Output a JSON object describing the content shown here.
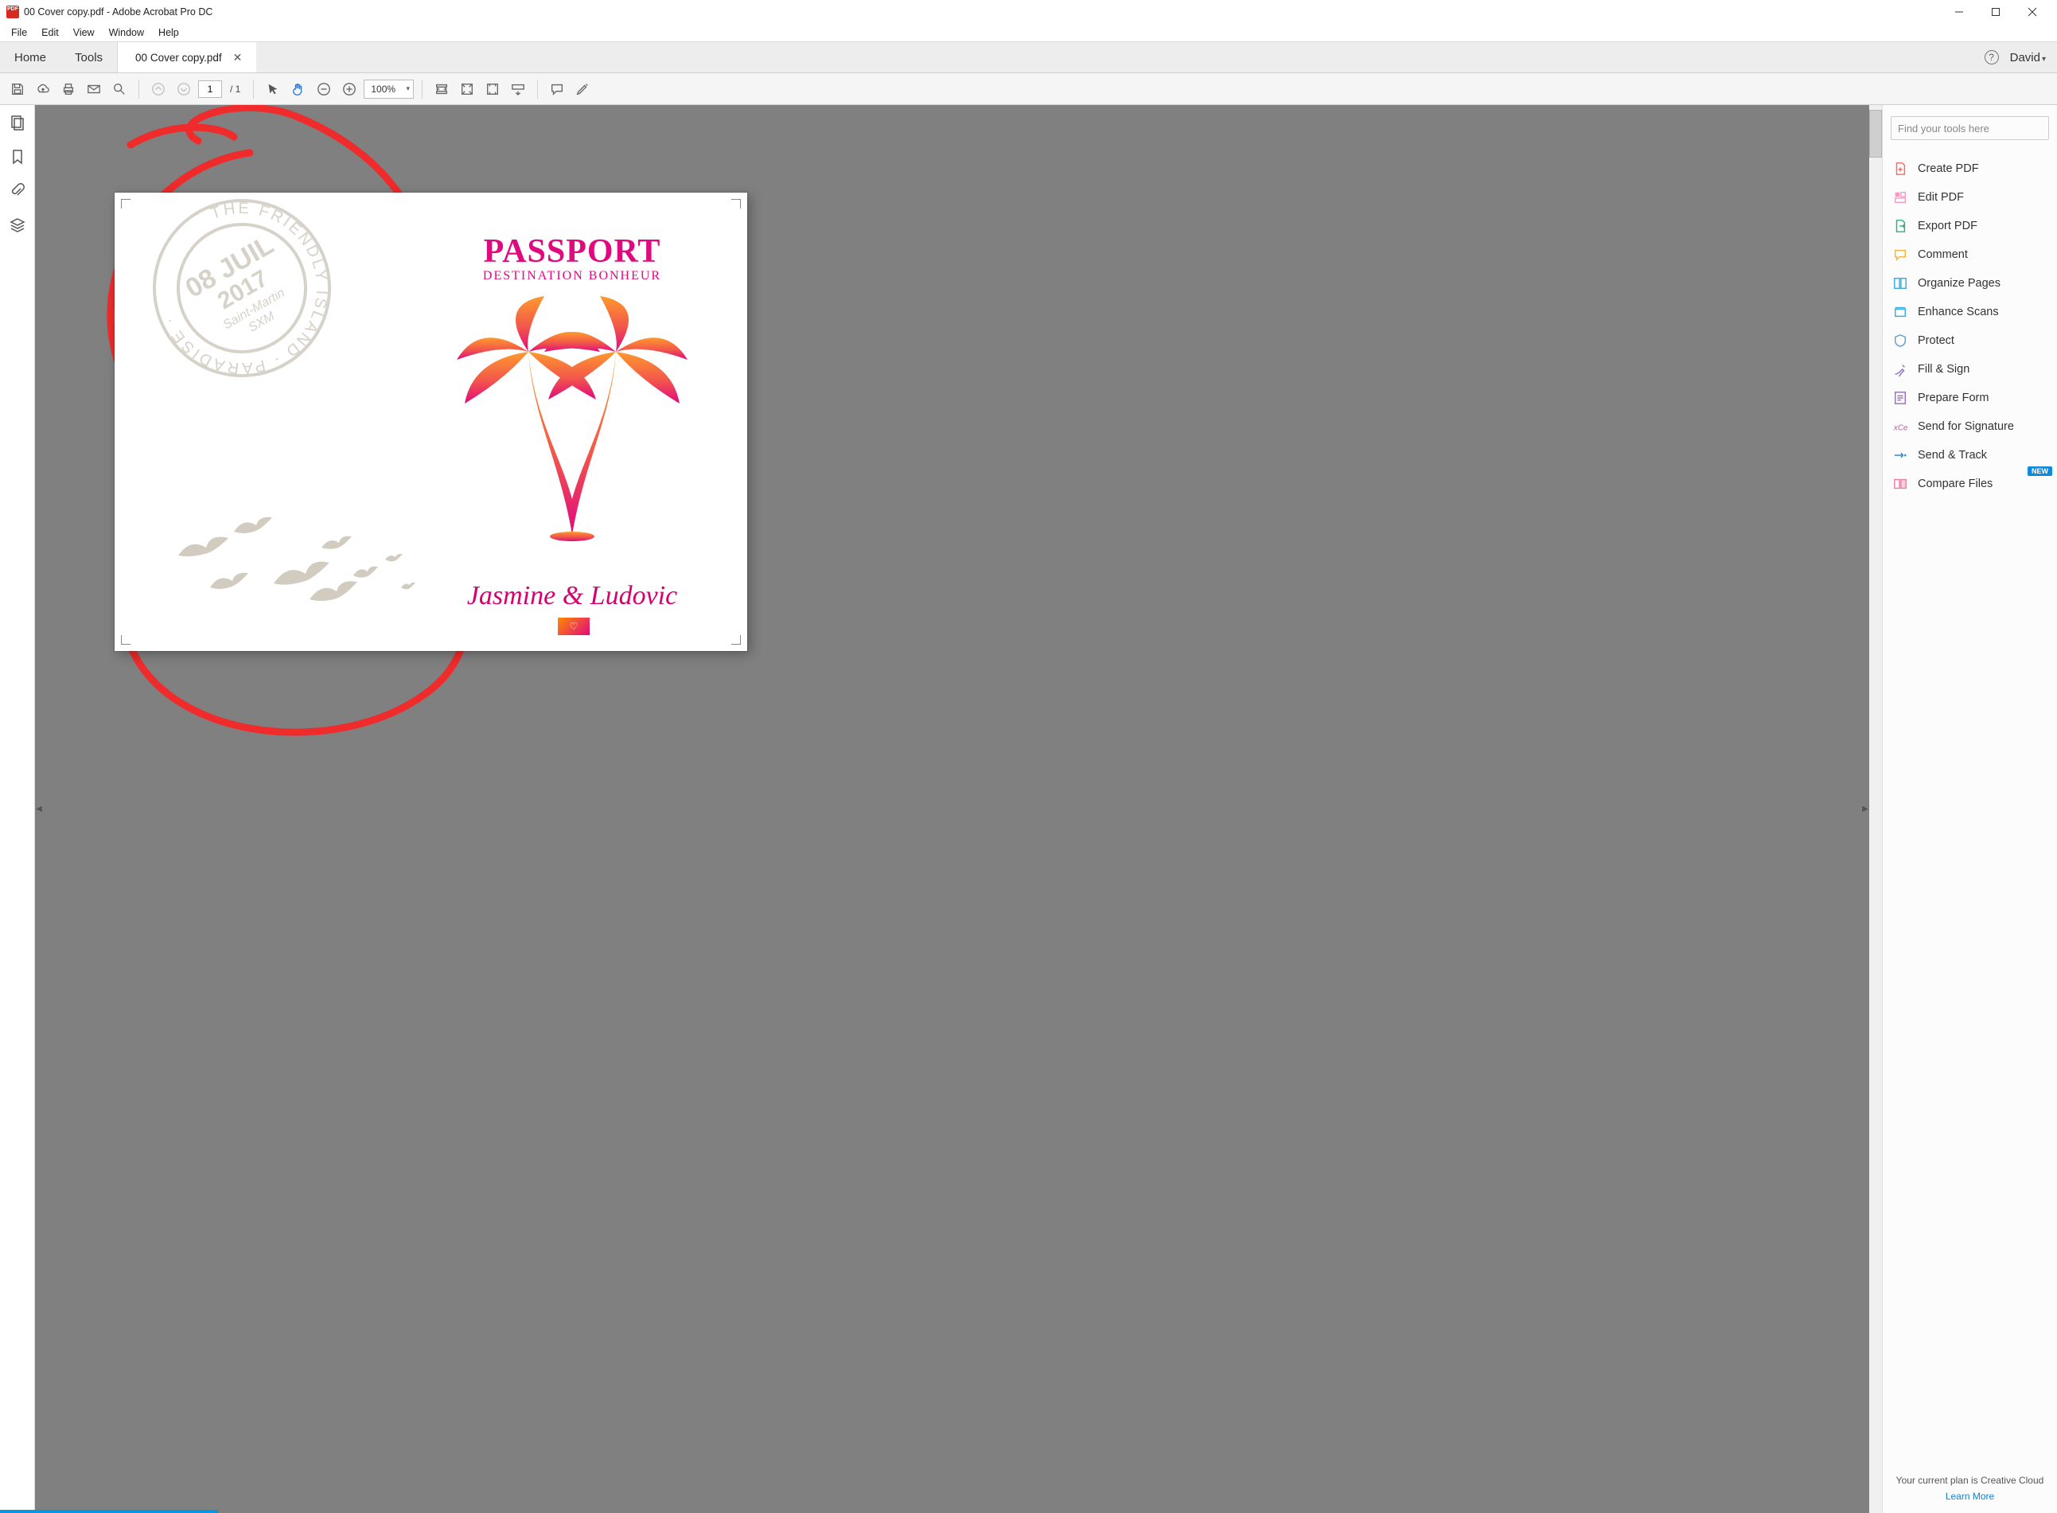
{
  "titlebar": {
    "title": "00 Cover copy.pdf - Adobe Acrobat Pro DC"
  },
  "menubar": {
    "items": [
      "File",
      "Edit",
      "View",
      "Window",
      "Help"
    ]
  },
  "tabstrip": {
    "home": "Home",
    "tools": "Tools",
    "filetab": "00 Cover copy.pdf",
    "user": "David"
  },
  "toolbar": {
    "page_current": "1",
    "page_total": "1",
    "zoom": "100%"
  },
  "rightpanel": {
    "search_placeholder": "Find your tools here",
    "items": [
      {
        "label": "Create PDF",
        "color": "#f06f5f",
        "icon": "file-plus"
      },
      {
        "label": "Edit PDF",
        "color": "#f29ac0",
        "icon": "edit"
      },
      {
        "label": "Export PDF",
        "color": "#28b37d",
        "icon": "export"
      },
      {
        "label": "Comment",
        "color": "#f2b63d",
        "icon": "comment"
      },
      {
        "label": "Organize Pages",
        "color": "#3aa9e0",
        "icon": "organize"
      },
      {
        "label": "Enhance Scans",
        "color": "#3aa9e0",
        "icon": "scan"
      },
      {
        "label": "Protect",
        "color": "#6aa0c9",
        "icon": "shield"
      },
      {
        "label": "Fill & Sign",
        "color": "#8a6fd0",
        "icon": "pen"
      },
      {
        "label": "Prepare Form",
        "color": "#9b6fbb",
        "icon": "form"
      },
      {
        "label": "Send for Signature",
        "color": "#c45aa0",
        "icon": "sign"
      },
      {
        "label": "Send & Track",
        "color": "#2f8fd8",
        "icon": "send"
      },
      {
        "label": "Compare Files",
        "color": "#ef7fa6",
        "icon": "compare",
        "badge": "NEW"
      }
    ],
    "footer_line": "Your current plan is Creative Cloud",
    "footer_link": "Learn More"
  },
  "document": {
    "passport_title": "PASSPORT",
    "passport_subtitle": "DESTINATION BONHEUR",
    "names": "Jasmine & Ludovic",
    "stamp_date": "08 JUIL",
    "stamp_year": "2017",
    "stamp_place": "Saint-Martin",
    "stamp_code": "SXM",
    "stamp_ring": "THE FRIENDLY ISLAND · PARADISE ·"
  }
}
